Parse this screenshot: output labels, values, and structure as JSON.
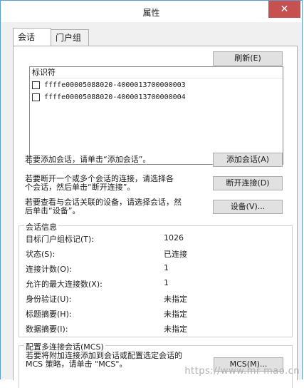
{
  "window": {
    "title": "属性",
    "close_glyph": "✕"
  },
  "tabs": [
    {
      "label": "会话"
    },
    {
      "label": "门户组"
    }
  ],
  "refresh_button": "刷新(E)",
  "list": {
    "header": "标识符",
    "items": [
      "ffffe00005088020-4000013700000003",
      "ffffe00005088020-4000013700000004"
    ]
  },
  "actions": {
    "add_desc": "若要添加会话，请单击“添加会话”。",
    "add_button": "添加会话(A)",
    "disconnect_desc_1": "若要断开一个或多个会话的连接，请选择各",
    "disconnect_desc_2": "个会话，然后单击“断开连接”。",
    "disconnect_button": "断开连接(D)",
    "devices_desc_1": "若要查看与会话关联的设备，请选择会话，然",
    "devices_desc_2": "后单击“设备”。",
    "devices_button": "设备(V)..."
  },
  "session_info": {
    "legend": "会话信息",
    "rows": [
      {
        "label": "目标门户组标记(T):",
        "value": "1026"
      },
      {
        "label": "状态(S):",
        "value": "已连接"
      },
      {
        "label": "连接计数(O):",
        "value": "1"
      },
      {
        "label": "允许的最大连接数(X):",
        "value": "1"
      },
      {
        "label": "身份验证(U):",
        "value": "未指定"
      },
      {
        "label": "标题摘要(H):",
        "value": "未指定"
      },
      {
        "label": "数据摘要(I):",
        "value": "未指定"
      }
    ]
  },
  "mcs": {
    "legend": "配置多连接会话(MCS)",
    "desc_1": "若要将附加连接添加到会话或配置选定会话的",
    "desc_2": "MCS 策略，请单击 \"MCS\"。",
    "button": "MCS(M)..."
  },
  "watermark": "https://www.mr-mao.cn"
}
